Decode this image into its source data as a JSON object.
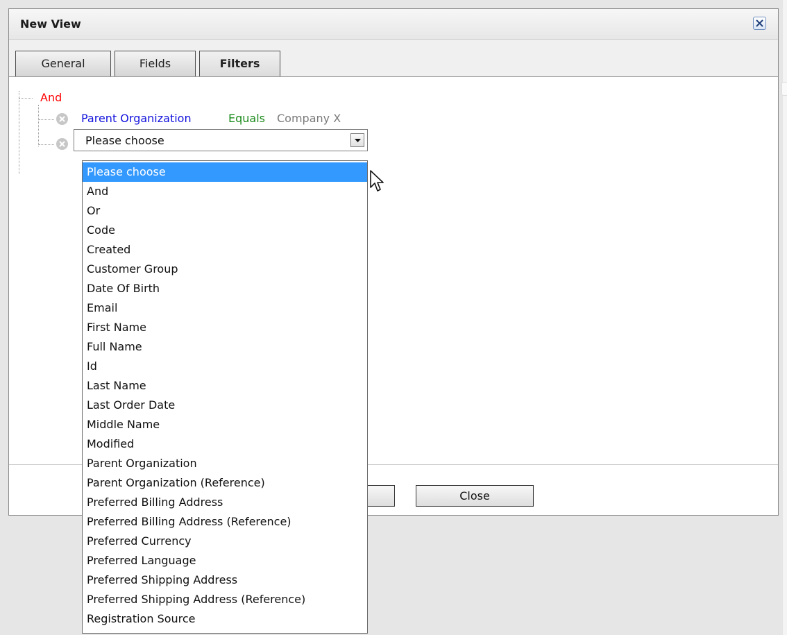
{
  "dialog": {
    "title": "New View"
  },
  "tabs": [
    {
      "label": "General",
      "active": false
    },
    {
      "label": "Fields",
      "active": false
    },
    {
      "label": "Filters",
      "active": true
    }
  ],
  "filter": {
    "root_operator": "And",
    "condition": {
      "field": "Parent Organization",
      "operator": "Equals",
      "value": "Company X"
    },
    "new_condition_select": {
      "selected": "Please choose"
    }
  },
  "dropdown": {
    "options": [
      "Please choose",
      "And",
      "Or",
      "Code",
      "Created",
      "Customer Group",
      "Date Of Birth",
      "Email",
      "First Name",
      "Full Name",
      "Id",
      "Last Name",
      "Last Order Date",
      "Middle Name",
      "Modified",
      "Parent Organization",
      "Parent Organization (Reference)",
      "Preferred Billing Address",
      "Preferred Billing Address (Reference)",
      "Preferred Currency",
      "Preferred Language",
      "Preferred Shipping Address",
      "Preferred Shipping Address (Reference)",
      "Registration Source"
    ],
    "highlighted": "Please choose"
  },
  "footer": {
    "close_label": "Close"
  },
  "colors": {
    "root_operator": "#ff0000",
    "field": "#1111dd",
    "operator": "#1a8a1a",
    "value": "#7a7a7a",
    "highlight": "#3399ff"
  },
  "icons": {
    "close": "close-icon",
    "remove": "remove-circle-icon",
    "dropdown_arrow": "chevron-down-icon",
    "cursor": "mouse-pointer-icon"
  }
}
